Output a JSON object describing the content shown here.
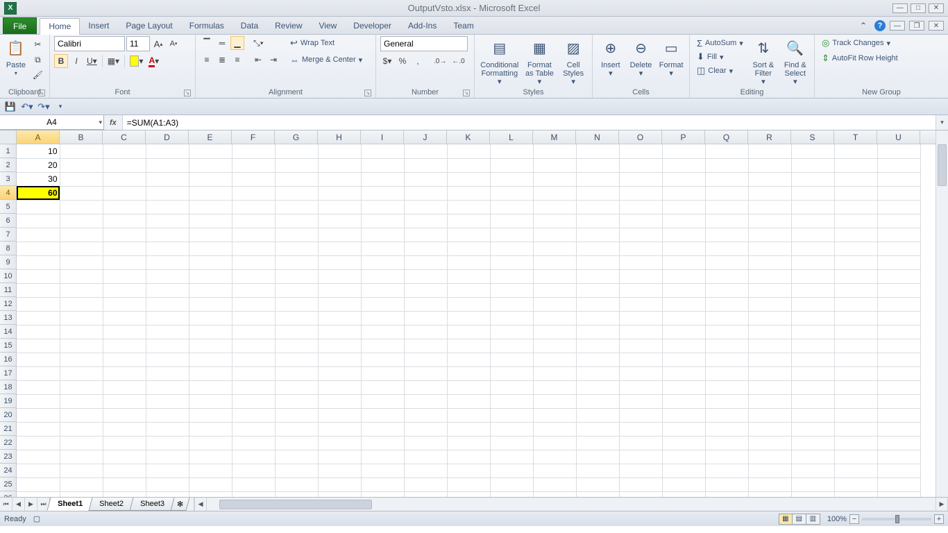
{
  "app": {
    "title": "OutputVsto.xlsx - Microsoft Excel",
    "iconLetter": "X"
  },
  "tabs": {
    "file": "File",
    "list": [
      "Home",
      "Insert",
      "Page Layout",
      "Formulas",
      "Data",
      "Review",
      "View",
      "Developer",
      "Add-Ins",
      "Team"
    ],
    "activeIndex": 0
  },
  "ribbon": {
    "clipboard": {
      "label": "Clipboard",
      "paste": "Paste"
    },
    "font": {
      "label": "Font",
      "name": "Calibri",
      "size": "11",
      "bold": "B",
      "italic": "I",
      "underline": "U"
    },
    "alignment": {
      "label": "Alignment",
      "wrap": "Wrap Text",
      "merge": "Merge & Center"
    },
    "number": {
      "label": "Number",
      "format": "General"
    },
    "styles": {
      "label": "Styles",
      "cond": "Conditional\nFormatting",
      "table": "Format\nas Table",
      "cell": "Cell\nStyles"
    },
    "cells": {
      "label": "Cells",
      "insert": "Insert",
      "delete": "Delete",
      "format": "Format"
    },
    "editing": {
      "label": "Editing",
      "autosum": "AutoSum",
      "fill": "Fill",
      "clear": "Clear",
      "sort": "Sort &\nFilter",
      "find": "Find &\nSelect"
    },
    "newgroup": {
      "label": "New Group",
      "track": "Track Changes",
      "autofit": "AutoFit Row Height"
    }
  },
  "formulaBar": {
    "nameBox": "A4",
    "formula": "=SUM(A1:A3)"
  },
  "grid": {
    "columns": [
      "A",
      "B",
      "C",
      "D",
      "E",
      "F",
      "G",
      "H",
      "I",
      "J",
      "K",
      "L",
      "M",
      "N",
      "O",
      "P",
      "Q",
      "R",
      "S",
      "T",
      "U"
    ],
    "selectedCol": 0,
    "rowCount": 26,
    "selectedRow": 4,
    "cells": {
      "A1": "10",
      "A2": "20",
      "A3": "30",
      "A4": "60"
    },
    "activeCell": "A4",
    "highlightYellow": [
      "A4"
    ],
    "boldCells": [
      "A4"
    ]
  },
  "sheets": {
    "list": [
      "Sheet1",
      "Sheet2",
      "Sheet3"
    ],
    "activeIndex": 0
  },
  "status": {
    "ready": "Ready",
    "zoom": "100%"
  }
}
